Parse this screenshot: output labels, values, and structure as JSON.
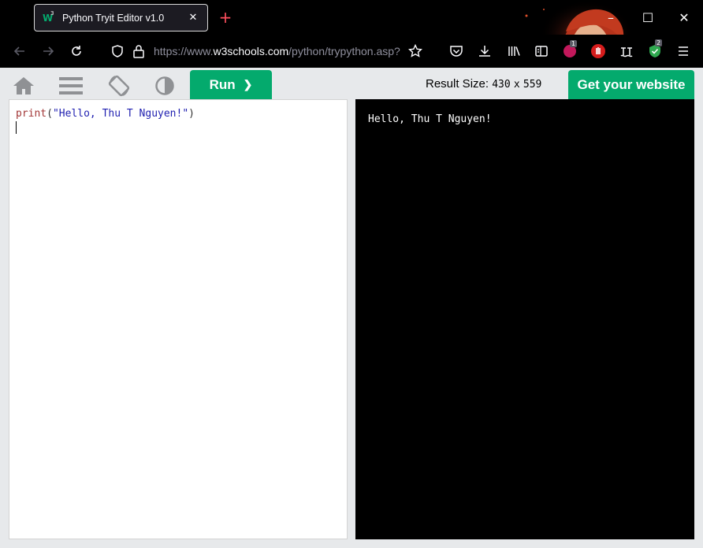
{
  "browser": {
    "tab": {
      "title": "Python Tryit Editor v1.0",
      "favicon_letter": "W",
      "favicon_sup": "3",
      "close_glyph": "✕"
    },
    "new_tab_glyph": "+",
    "window_controls": {
      "minimize": "–",
      "maximize": "☐",
      "close": "✕"
    },
    "url": {
      "prefix": "https://www.",
      "host": "w3schools.com",
      "path": "/python/trypython.asp?"
    },
    "badges": {
      "extension_count": "1",
      "shield_count": "2"
    },
    "icons": [
      "back-icon",
      "forward-icon",
      "reload-icon",
      "tracking-shield-icon",
      "lock-icon",
      "bookmark-star-icon",
      "pocket-icon",
      "download-icon",
      "library-icon",
      "reader-view-icon",
      "extension-icon",
      "hand-icon",
      "wave-icon",
      "shield-check-icon",
      "hamburger-menu-icon"
    ]
  },
  "w3toolbar": {
    "icons": [
      "home-icon",
      "menu-icon",
      "rotate-icon",
      "contrast-icon"
    ],
    "run_label": "Run",
    "run_chevron": "❯",
    "result_size_label": "Result Size:",
    "result_width": "430",
    "result_x": "x",
    "result_height": "559",
    "get_website_label": "Get your website"
  },
  "editor": {
    "code_kw": "print",
    "code_open": "(",
    "code_str": "\"Hello, Thu T Nguyen!\"",
    "code_close": ")"
  },
  "output": {
    "text": "Hello, Thu T Nguyen!"
  },
  "colors": {
    "accent": "#04aa6d",
    "toolbar_bg": "#e7e9eb",
    "browser_bg": "#000000",
    "keyword": "#a23636",
    "string": "#1f1fb0"
  }
}
